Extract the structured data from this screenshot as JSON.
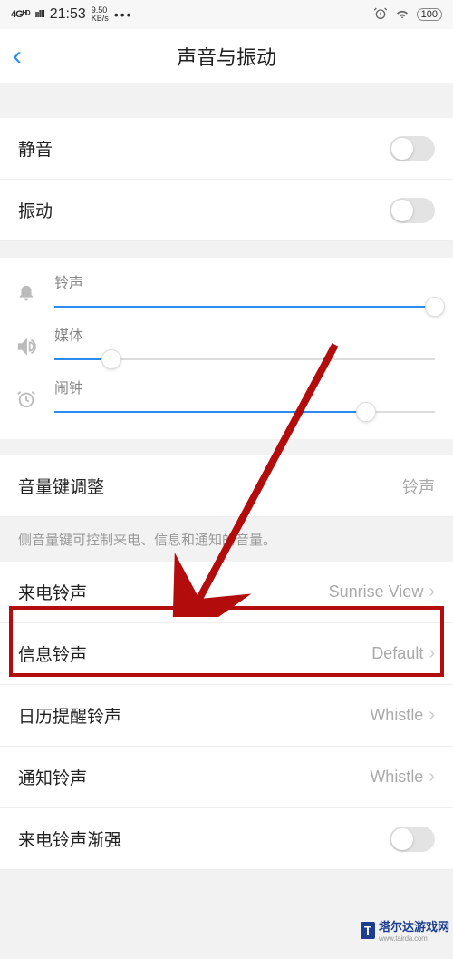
{
  "status": {
    "signal": "4Gᴴᴰ",
    "bars": "ıılll",
    "time": "21:53",
    "speed_value": "9.50",
    "speed_unit": "KB/s",
    "dots": "•••",
    "alarm_icon": "⏰",
    "wifi_icon": "ᯤ",
    "battery": "100"
  },
  "header": {
    "back": "‹",
    "title": "声音与振动"
  },
  "rows": {
    "mute": {
      "label": "静音"
    },
    "vibrate": {
      "label": "振动"
    },
    "volume_key": {
      "label": "音量键调整",
      "value": "铃声"
    },
    "hint": "侧音量键可控制来电、信息和通知的音量。",
    "call_ring": {
      "label": "来电铃声",
      "value": "Sunrise View"
    },
    "msg_ring": {
      "label": "信息铃声",
      "value": "Default"
    },
    "cal_ring": {
      "label": "日历提醒铃声",
      "value": "Whistle"
    },
    "notif_ring": {
      "label": "通知铃声",
      "value": "Whistle"
    },
    "crescendo": {
      "label": "来电铃声渐强"
    }
  },
  "sliders": {
    "ring": {
      "label": "铃声",
      "value": 100
    },
    "media": {
      "label": "媒体",
      "value": 15
    },
    "alarm": {
      "label": "闹钟",
      "value": 82
    }
  },
  "watermark": {
    "t": "T",
    "name": "塔尔达游戏网",
    "url": "www.tairda.com"
  }
}
